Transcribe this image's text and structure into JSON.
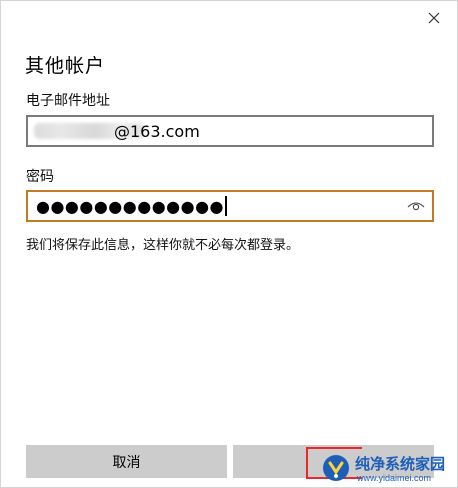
{
  "dialog": {
    "title": "其他帐户",
    "close_icon": "close-icon"
  },
  "email": {
    "label": "电子邮件地址",
    "value_visible_suffix": "@163.com"
  },
  "password": {
    "label": "密码",
    "masked_value": "●●●●●●●●●●●●●",
    "reveal_icon": "eye-icon"
  },
  "info_text": "我们将保存此信息，这样你就不必每次都登录。",
  "buttons": {
    "cancel_label": "取消"
  },
  "watermark": {
    "title": "纯净系统家园",
    "url": "www.yidaimei.com"
  },
  "colors": {
    "focus_border": "#c47a22",
    "input_border": "#7a7a7a",
    "button_bg": "#cccccc",
    "highlight_red": "#e8282b",
    "watermark_blue": "#1d5fb8"
  }
}
